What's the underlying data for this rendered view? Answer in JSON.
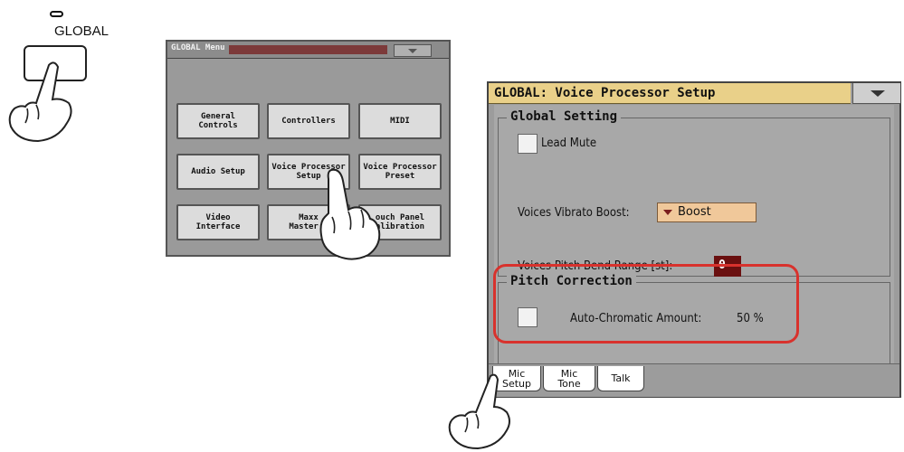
{
  "hardware": {
    "button_label": "GLOBAL"
  },
  "global_menu": {
    "title": "GLOBAL Menu",
    "buttons": [
      "General\nControls",
      "Controllers",
      "MIDI",
      "Audio Setup",
      "Voice Processor\nSetup",
      "Voice Processor\nPreset",
      "Video\nInterface",
      "Maxx\nMaster E",
      "ouch Panel\nalibration"
    ]
  },
  "voice_panel": {
    "title": "GLOBAL: Voice Processor Setup",
    "global_setting": {
      "group_title": "Global Setting",
      "lead_mute_label": "Lead Mute",
      "vibrato_label": "Voices Vibrato Boost:",
      "vibrato_value": "Boost",
      "pitch_bend_label": "Voices Pitch Bend Range [st]:",
      "pitch_bend_value": "0"
    },
    "pitch_correction": {
      "group_title": "Pitch Correction",
      "auto_chromatic_label": "Auto-Chromatic Amount:",
      "auto_chromatic_value": "50 %"
    },
    "tabs": [
      "Mic\nSetup",
      "Mic\nTone",
      "Talk"
    ]
  },
  "colors": {
    "title_bar": "#e9d089",
    "highlight_circle": "#d8322d",
    "value_field": "#6a1010",
    "dropdown": "#f0c89a"
  }
}
